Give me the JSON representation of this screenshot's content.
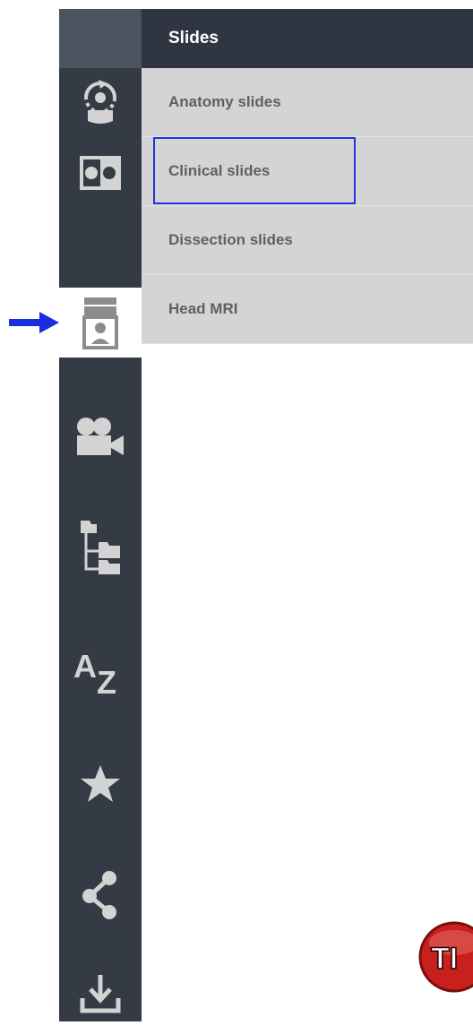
{
  "panel": {
    "title": "Slides",
    "items": [
      {
        "label": "Anatomy slides"
      },
      {
        "label": "Clinical slides"
      },
      {
        "label": "Dissection slides"
      },
      {
        "label": "Head MRI"
      }
    ]
  },
  "rail": {
    "icons": [
      "rotate-3d-icon",
      "two-panel-icon",
      "slides-stack-icon",
      "video-camera-icon",
      "folder-tree-icon",
      "a-z-index-icon",
      "star-favorites-icon",
      "share-icon",
      "download-icon"
    ],
    "active": "slides-stack-icon",
    "az_label": "AZ"
  },
  "annotations": {
    "tip_badge_text": "TI",
    "highlighted_item": "Clinical slides"
  },
  "colors": {
    "rail_bg": "#343b45",
    "header_bg": "#2f3641",
    "list_bg": "#d4d4d4",
    "icon_color": "#d3d3d3",
    "highlight": "#2233dd",
    "pointer": "#1a2de0",
    "tip_red": "#c8201c"
  }
}
